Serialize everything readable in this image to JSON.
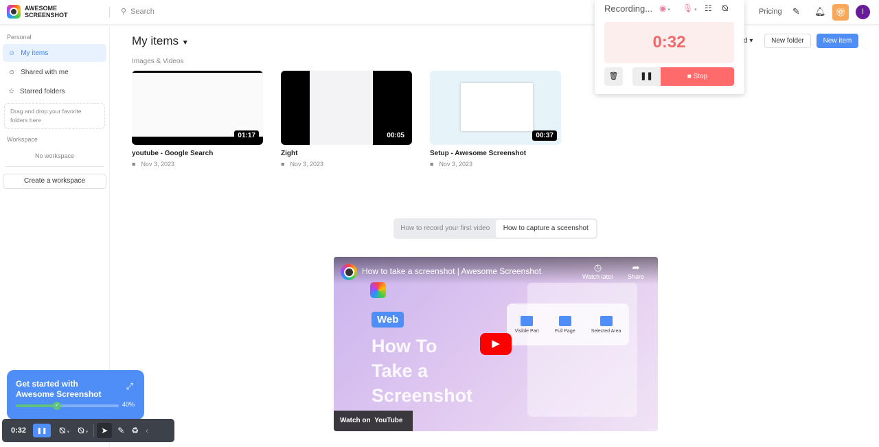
{
  "header": {
    "logo_line1": "AWESOME",
    "logo_line2": "SCREENSHOT",
    "search_placeholder": "Search",
    "pricing": "Pricing",
    "avatar_initial": "I"
  },
  "sidebar": {
    "personal_label": "Personal",
    "items": [
      {
        "label": "My items"
      },
      {
        "label": "Shared with me"
      },
      {
        "label": "Starred folders"
      }
    ],
    "drop_hint": "Drag and drop your favorite folders here",
    "workspace_label": "Workspace",
    "no_workspace": "No workspace",
    "create_workspace": "Create a workspace"
  },
  "main": {
    "title": "My items",
    "section": "Images & Videos",
    "sort_partial": "d",
    "new_folder": "New folder",
    "new_item": "New item",
    "items": [
      {
        "name": "youtube - Google Search",
        "date": "Nov 3, 2023",
        "duration": "01:17"
      },
      {
        "name": "Zight",
        "date": "Nov 3, 2023",
        "duration": "00:05"
      },
      {
        "name": "Setup - Awesome Screenshot",
        "date": "Nov 3, 2023",
        "duration": "00:37"
      }
    ],
    "tabs": [
      "How to record your first video",
      "How to capture a sceenshot"
    ]
  },
  "video": {
    "title": "How to take a screenshot | Awesome Screenshot",
    "watch_later": "Watch later",
    "share": "Share",
    "badge": "Web",
    "headline1": "How To",
    "headline2": "Take a",
    "headline3": "Screenshot",
    "options": [
      "Visible Part",
      "Full Page",
      "Selected Area"
    ],
    "watch_on": "Watch on",
    "youtube": "YouTube"
  },
  "recorder": {
    "title": "Recording...",
    "timer": "0:32",
    "stop": "Stop"
  },
  "onboarding": {
    "title_line1": "Get started with",
    "title_line2": "Awesome Screenshot",
    "progress_percent": 40,
    "progress_label": "40%"
  },
  "toolbar": {
    "timer": "0:32"
  },
  "colors": {
    "accent": "#4f8ef7",
    "record": "#ff6b6b",
    "avatar": "#6a1b9a"
  }
}
